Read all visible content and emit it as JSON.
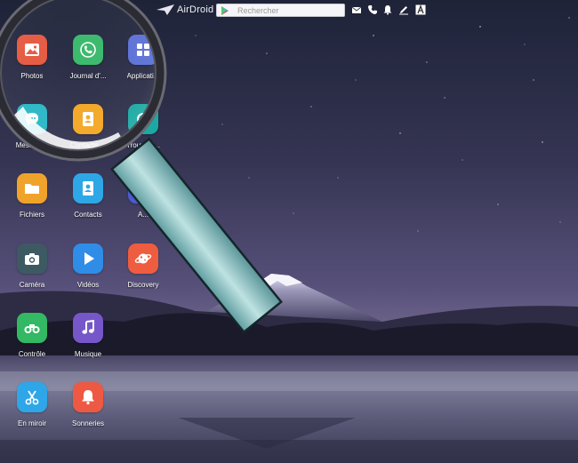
{
  "topbar": {
    "brand": "AirDroid",
    "search_placeholder": "Rechercher",
    "icons": [
      "mail-icon",
      "phone-icon",
      "bell-icon",
      "pen-icon",
      "font-icon"
    ]
  },
  "apps": [
    {
      "id": "photos",
      "label": "Photos",
      "color": "#e5573f",
      "icon": "photo-icon"
    },
    {
      "id": "journal",
      "label": "Journal d'...",
      "color": "#37b86a",
      "icon": "phone-call-icon"
    },
    {
      "id": "applications",
      "label": "Applicati...",
      "color": "#5a6fd6",
      "icon": "apps-icon"
    },
    {
      "id": "messages",
      "label": "Messages",
      "color": "#28b6c6",
      "icon": "chat-icon"
    },
    {
      "id": "contacts-fav",
      "label": "Contacts ...",
      "color": "#f3a623",
      "icon": "contact-card-icon"
    },
    {
      "id": "trouver",
      "label": "Trouver l...",
      "color": "#1aa9a3",
      "icon": "locate-icon"
    },
    {
      "id": "fichiers",
      "label": "Fichiers",
      "color": "#f0a32b",
      "icon": "folder-icon"
    },
    {
      "id": "contacts",
      "label": "Contacts",
      "color": "#2ea7e6",
      "icon": "contacts-icon"
    },
    {
      "id": "a-app",
      "label": "A...",
      "color": "#4b5bd1",
      "icon": "app-icon"
    },
    {
      "id": "camera",
      "label": "Caméra",
      "color": "#3d5a63",
      "icon": "camera-icon"
    },
    {
      "id": "videos",
      "label": "Vidéos",
      "color": "#2f8de8",
      "icon": "video-play-icon"
    },
    {
      "id": "discovery",
      "label": "Discovery",
      "color": "#ee5d3f",
      "icon": "planet-icon"
    },
    {
      "id": "controle",
      "label": "Contrôle",
      "color": "#33b864",
      "icon": "binoculars-icon"
    },
    {
      "id": "musique",
      "label": "Musique",
      "color": "#7657c9",
      "icon": "music-icon"
    },
    {
      "id": "miroir",
      "label": "En miroir",
      "color": "#2ea6e8",
      "icon": "scissors-icon"
    },
    {
      "id": "sonneries",
      "label": "Sonneries",
      "color": "#ee5944",
      "icon": "bell-ring-icon"
    }
  ]
}
